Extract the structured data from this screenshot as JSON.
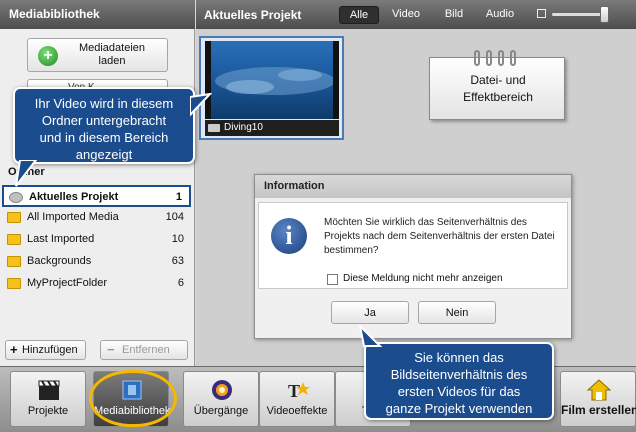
{
  "left_panel": {
    "title": "Mediabibliothek",
    "load_button": "Mediadateien\nladen",
    "record_button": "Von K…",
    "folders_title": "Ordner",
    "folders": [
      {
        "name": "Aktuelles Projekt",
        "count": "1"
      },
      {
        "name": "All Imported Media",
        "count": "104"
      },
      {
        "name": "Last Imported",
        "count": "10"
      },
      {
        "name": "Backgrounds",
        "count": "63"
      },
      {
        "name": "MyProjectFolder",
        "count": "6"
      }
    ],
    "add_button": "Hinzufügen",
    "remove_button": "Entfernen"
  },
  "right_panel": {
    "title": "Aktuelles Projekt",
    "tabs": [
      "Alle",
      "Video",
      "Bild",
      "Audio"
    ],
    "active_tab": "Alle",
    "clip_name": "Diving10",
    "note": "Datei- und\nEffektbereich"
  },
  "dialog": {
    "title": "Information",
    "message": "Möchten Sie wirklich das Seitenverhältnis des Projekts nach dem Seitenverhältnis der ersten Datei bestimmen?",
    "checkbox_label": "Diese Meldung nicht mehr anzeigen",
    "yes": "Ja",
    "no": "Nein"
  },
  "callouts": {
    "first": "Ihr Video wird in diesem\nOrdner untergebracht\nund in diesem Bereich\nangezeigt",
    "second": "Sie können das\nBildseitenverhältnis des\nersten Videos für das\nganze Projekt verwenden"
  },
  "toolbar": {
    "projekte": "Projekte",
    "mediabibliothek": "Mediabibliothek",
    "uebergaenge": "Übergänge",
    "videoeffekte": "Videoeffekte",
    "titel": "Te…",
    "film_erstellen": "Film erstellen"
  },
  "colors": {
    "callout_bg": "#1b4d8e",
    "highlight": "#f5b800",
    "header_bg": "#5a5a5a"
  }
}
